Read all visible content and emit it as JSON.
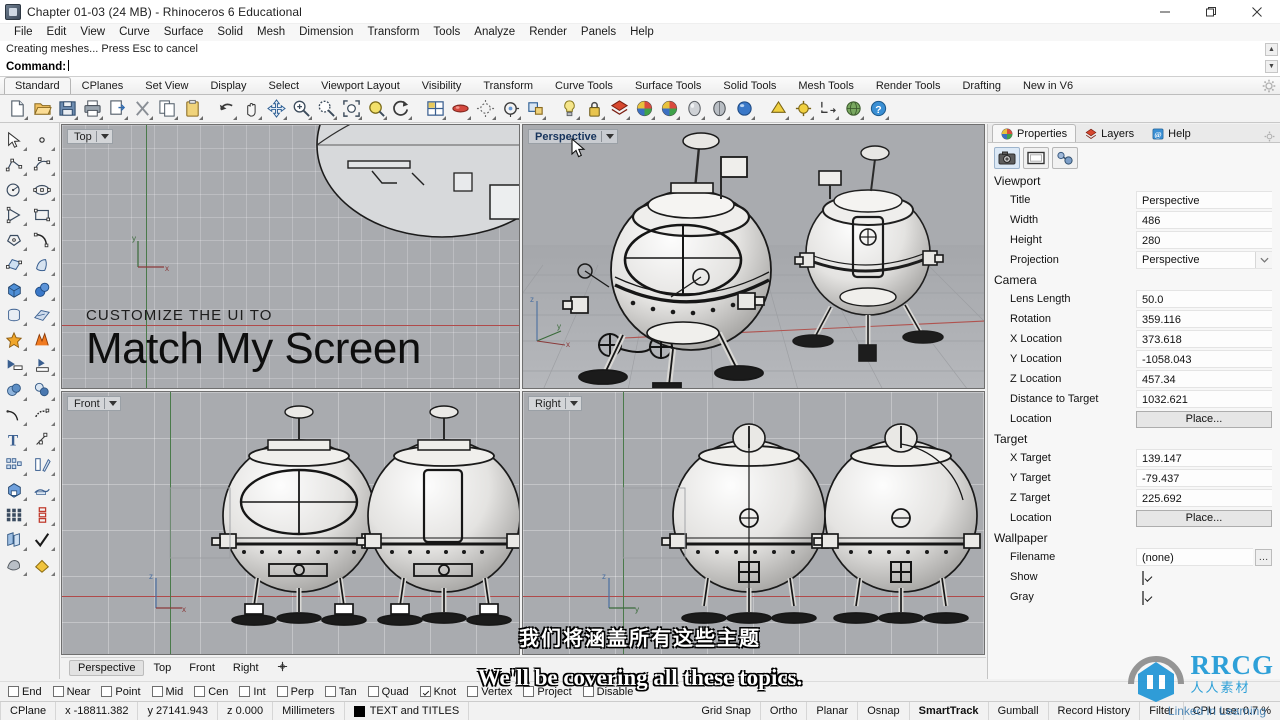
{
  "window": {
    "title": "Chapter 01-03 (24 MB) - Rhinoceros 6 Educational",
    "minimize": "—",
    "maximize": "❐",
    "close": "✕"
  },
  "menubar": {
    "items": [
      "File",
      "Edit",
      "View",
      "Curve",
      "Surface",
      "Solid",
      "Mesh",
      "Dimension",
      "Transform",
      "Tools",
      "Analyze",
      "Render",
      "Panels",
      "Help"
    ]
  },
  "command": {
    "history": "Creating meshes... Press Esc to cancel",
    "prompt": "Command:",
    "value": ""
  },
  "toolbar_tabs": {
    "items": [
      "Standard",
      "CPlanes",
      "Set View",
      "Display",
      "Select",
      "Viewport Layout",
      "Visibility",
      "Transform",
      "Curve Tools",
      "Surface Tools",
      "Solid Tools",
      "Mesh Tools",
      "Render Tools",
      "Drafting",
      "New in V6"
    ],
    "active": "Standard",
    "options_icon": "gear-icon"
  },
  "main_toolbar": {
    "icons": [
      "new-file-icon",
      "open-folder-icon",
      "save-icon",
      "print-icon",
      "copy-to-clipboard-icon",
      "delete-x-icon",
      "copy-icon",
      "paste-icon",
      "undo-icon",
      "pan-icon",
      "move-icon",
      "zoom-in-icon",
      "zoom-window-icon",
      "zoom-extents-icon",
      "zoom-selected-icon",
      "rotate-view-icon",
      "four-viewport-icon",
      "shade-red-icon",
      "render-preview-icon",
      "render-icon",
      "render-properties-icon",
      "light-bulb-icon",
      "lock-icon",
      "layers-icon",
      "material-icon",
      "color-wheel-icon",
      "sphere-gray-icon",
      "sphere-shaded-icon",
      "sphere-blue-icon",
      "mesh-from-surface-icon",
      "mesh-settings-icon",
      "dimension-icon",
      "earth-globe-icon",
      "help-question-icon"
    ]
  },
  "left_toolbar": {
    "icons": [
      "select-arrow-icon",
      "point-icon",
      "polyline-icon",
      "control-point-curve-icon",
      "circle-icon",
      "ellipse-icon",
      "triangle-polygon-icon",
      "rectangle-icon",
      "polygon-icon",
      "curve-arc-icon",
      "surface-from-points-icon",
      "surface-sweep-icon",
      "box-icon",
      "sphere-icon",
      "cylinder-icon",
      "surface-planar-icon",
      "explode-star-icon",
      "boolean-split-icon",
      "trim-icon",
      "split-icon",
      "boolean-union-icon",
      "boolean-difference-icon",
      "fillet-curve-icon",
      "blend-curve-icon",
      "text-icon",
      "offset-icon",
      "array-icon",
      "mirror-icon",
      "box-edit-icon",
      "flow-icon",
      "grid-array-icon",
      "linear-array-red-icon",
      "copy-object-icon",
      "check-mark-icon",
      "render-mesh-icon",
      "paint-bucket-icon"
    ]
  },
  "viewports": [
    {
      "name": "Top",
      "active": false
    },
    {
      "name": "Perspective",
      "active": true
    },
    {
      "name": "Front",
      "active": false
    },
    {
      "name": "Right",
      "active": false
    }
  ],
  "promo_overlay": {
    "kicker": "CUSTOMIZE THE UI TO",
    "headline": "Match My Screen"
  },
  "viewport_tabs": {
    "items": [
      "Perspective",
      "Top",
      "Front",
      "Right"
    ],
    "active": "Perspective",
    "add_icon": "add-viewport-icon"
  },
  "osnap": {
    "items": [
      {
        "label": "End",
        "checked": false
      },
      {
        "label": "Near",
        "checked": false
      },
      {
        "label": "Point",
        "checked": false
      },
      {
        "label": "Mid",
        "checked": false
      },
      {
        "label": "Cen",
        "checked": false
      },
      {
        "label": "Int",
        "checked": false
      },
      {
        "label": "Perp",
        "checked": false
      },
      {
        "label": "Tan",
        "checked": false
      },
      {
        "label": "Quad",
        "checked": false
      },
      {
        "label": "Knot",
        "checked": true
      },
      {
        "label": "Vertex",
        "checked": false
      },
      {
        "label": "Project",
        "checked": false
      },
      {
        "label": "Disable",
        "checked": false
      }
    ]
  },
  "statusbar": {
    "cplane": "CPlane",
    "x": "x -18811.382",
    "y": "y 27141.943",
    "z": "z 0.000",
    "units": "Millimeters",
    "layer": "TEXT and TITLES",
    "layer_color": "#000000",
    "toggles": [
      "Grid Snap",
      "Ortho",
      "Planar",
      "Osnap",
      "SmartTrack",
      "Gumball",
      "Record History",
      "Filter"
    ],
    "active_toggle": "SmartTrack",
    "cpu": "CPU use: 0.7 %"
  },
  "right_panel": {
    "tabs": [
      {
        "label": "Properties",
        "icon": "color-wheel-icon",
        "active": true
      },
      {
        "label": "Layers",
        "icon": "layers-icon",
        "active": false
      },
      {
        "label": "Help",
        "icon": "help-icon",
        "active": false
      }
    ],
    "options_icon": "gear-icon",
    "mode_buttons": [
      "camera-icon",
      "viewport-frame-icon",
      "link-chain-icon"
    ],
    "sections": [
      {
        "title": "Viewport",
        "rows": [
          {
            "label": "Title",
            "value": "Perspective",
            "kind": "text"
          },
          {
            "label": "Width",
            "value": "486",
            "kind": "text"
          },
          {
            "label": "Height",
            "value": "280",
            "kind": "text"
          },
          {
            "label": "Projection",
            "value": "Perspective",
            "kind": "combo"
          }
        ]
      },
      {
        "title": "Camera",
        "rows": [
          {
            "label": "Lens Length",
            "value": "50.0",
            "kind": "text"
          },
          {
            "label": "Rotation",
            "value": "359.116",
            "kind": "text"
          },
          {
            "label": "X Location",
            "value": "373.618",
            "kind": "text"
          },
          {
            "label": "Y Location",
            "value": "-1058.043",
            "kind": "text"
          },
          {
            "label": "Z Location",
            "value": "457.34",
            "kind": "text"
          },
          {
            "label": "Distance to Target",
            "value": "1032.621",
            "kind": "text"
          },
          {
            "label": "Location",
            "value": "Place...",
            "kind": "button"
          }
        ]
      },
      {
        "title": "Target",
        "rows": [
          {
            "label": "X Target",
            "value": "139.147",
            "kind": "text"
          },
          {
            "label": "Y Target",
            "value": "-79.437",
            "kind": "text"
          },
          {
            "label": "Z Target",
            "value": "225.692",
            "kind": "text"
          },
          {
            "label": "Location",
            "value": "Place...",
            "kind": "button"
          }
        ]
      },
      {
        "title": "Wallpaper",
        "rows": [
          {
            "label": "Filename",
            "value": "(none)",
            "kind": "file"
          },
          {
            "label": "Show",
            "value": "",
            "kind": "check"
          },
          {
            "label": "Gray",
            "value": "",
            "kind": "check"
          }
        ]
      }
    ]
  },
  "subtitles": {
    "chinese": "我们将涵盖所有这些主题",
    "english": "We'll be covering all these topics."
  },
  "watermark": {
    "text": "RRCG",
    "brand_top": "RRCG",
    "brand_bottom": "人人素材",
    "linkedin": "Linked in Learning"
  },
  "colors": {
    "viewport_bg": "#a9abaf",
    "accent_blue": "#1f9ad6",
    "panel_bg": "#f7f7f7",
    "active_tab": "#16335c"
  }
}
